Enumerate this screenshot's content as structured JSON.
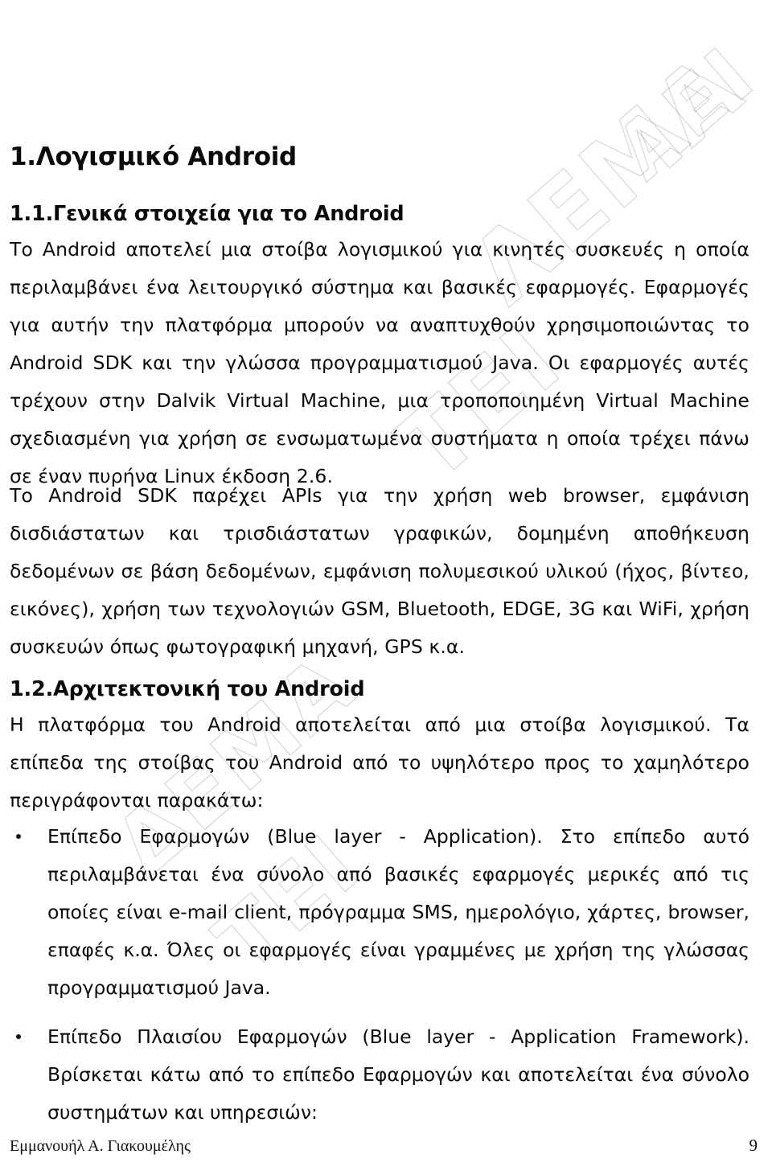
{
  "document": {
    "language": "el",
    "page_number": "9",
    "background_color": "#ffffff",
    "text_color": "#0a0a0a"
  },
  "watermark": {
    "description": "faint diagonal outlined letters across the page",
    "color": "#78788a",
    "fragments": [
      "ΛΕΜΑ",
      "ΤΕΙ",
      "ΔΕΜΑ",
      "ΤΕΙ",
      "ΑΕΙ"
    ]
  },
  "headings": {
    "h1": "1.Λογισμικό Android",
    "h2_general": "1.1.Γενικά στοιχεία για το Android",
    "h2_architecture": "1.2.Αρχιτεκτονική του Android"
  },
  "paragraphs": {
    "p1": "Το Android αποτελεί μια στοίβα λογισμικού για κινητές συσκευές η οποία περιλαμβάνει ένα λειτουργικό σύστημα και βασικές εφαρμογές. Εφαρμογές για αυτήν την πλατφόρμα μπορούν να αναπτυχθούν χρησιμοποιώντας το Android SDK και την γλώσσα προγραμματισμού Java. Οι εφαρμογές αυτές τρέχουν στην Dalvik Virtual Machine, μια τροποποιημένη Virtual Machine σχεδιασμένη για χρήση σε ενσωματωμένα συστήματα η οποία τρέχει πάνω σε έναν πυρήνα Linux έκδοση 2.6.",
    "p2": "Το Android SDK παρέχει APIs για την χρήση web browser, εμφάνιση δισδιάστατων και τρισδιάστατων γραφικών, δομημένη αποθήκευση δεδομένων σε βάση δεδομένων, εμφάνιση πολυμεσικού υλικού (ήχος, βίντεο, εικόνες), χρήση των τεχνολογιών GSM, Bluetooth, EDGE, 3G και WiFi, χρήση συσκευών όπως φωτογραφική μηχανή, GPS κ.α.",
    "p3": "Η πλατφόρμα του Android αποτελείται από μια στοίβα λογισμικού. Τα επίπεδα της στοίβας του Android από το υψηλότερο προς το χαμηλότερο περιγράφονται παρακάτω:"
  },
  "list": {
    "items": [
      "Επίπεδο Εφαρμογών (Blue layer - Application). Στο επίπεδο αυτό περιλαμβάνεται ένα σύνολο από βασικές εφαρμογές μερικές από τις οποίες είναι e-mail client, πρόγραμμα SMS, ημερολόγιο, χάρτες, browser, επαφές κ.α. Όλες οι εφαρμογές είναι γραμμένες με χρήση της γλώσσας προγραμματισμού Java.",
      "Επίπεδο Πλαισίου Εφαρμογών (Blue layer - Application Framework). Βρίσκεται κάτω από το επίπεδο Εφαρμογών και αποτελείται ένα σύνολο συστημάτων και υπηρεσιών:"
    ]
  },
  "footer": {
    "author": "Εμμανουήλ Α. Γιακουμέλης",
    "page_number": "9"
  }
}
